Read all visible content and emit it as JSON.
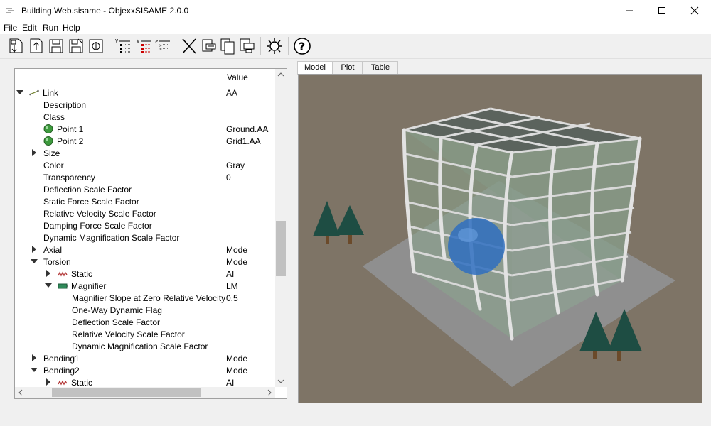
{
  "window": {
    "title": "Building.Web.sisame - ObjexxSISAME 2.0.0"
  },
  "menu": [
    "File",
    "Edit",
    "Run",
    "Help"
  ],
  "toolbar": {
    "icons": [
      "new-icon",
      "open-icon",
      "save-icon",
      "save-as-icon",
      "close-file-icon",
      "tree-expand-icon",
      "tree-list-icon",
      "tree-values-icon",
      "delete-icon",
      "cut-icon",
      "copy-icon",
      "paste-icon",
      "settings-icon",
      "help-icon"
    ]
  },
  "tree": {
    "header_value": "Value",
    "rows": [
      {
        "label": "Link",
        "value": "AA",
        "depth": 0,
        "arrow": "down",
        "icon": "link"
      },
      {
        "label": "Description",
        "value": "",
        "depth": 1,
        "arrow": "",
        "icon": ""
      },
      {
        "label": "Class",
        "value": "",
        "depth": 1,
        "arrow": "",
        "icon": ""
      },
      {
        "label": "Point 1",
        "value": "Ground.AA",
        "depth": 1,
        "arrow": "",
        "icon": "point"
      },
      {
        "label": "Point 2",
        "value": "Grid1.AA",
        "depth": 1,
        "arrow": "",
        "icon": "point"
      },
      {
        "label": "Size",
        "value": "",
        "depth": 1,
        "arrow": "right",
        "icon": ""
      },
      {
        "label": "Color",
        "value": "Gray",
        "depth": 1,
        "arrow": "",
        "icon": ""
      },
      {
        "label": "Transparency",
        "value": "0",
        "depth": 1,
        "arrow": "",
        "icon": ""
      },
      {
        "label": "Deflection Scale Factor",
        "value": "",
        "depth": 1,
        "arrow": "",
        "icon": ""
      },
      {
        "label": "Static Force Scale Factor",
        "value": "",
        "depth": 1,
        "arrow": "",
        "icon": ""
      },
      {
        "label": "Relative Velocity Scale Factor",
        "value": "",
        "depth": 1,
        "arrow": "",
        "icon": ""
      },
      {
        "label": "Damping Force Scale Factor",
        "value": "",
        "depth": 1,
        "arrow": "",
        "icon": ""
      },
      {
        "label": "Dynamic Magnification Scale Factor",
        "value": "",
        "depth": 1,
        "arrow": "",
        "icon": ""
      },
      {
        "label": "Axial",
        "value": "Mode",
        "depth": 1,
        "arrow": "right",
        "icon": ""
      },
      {
        "label": "Torsion",
        "value": "Mode",
        "depth": 1,
        "arrow": "down",
        "icon": ""
      },
      {
        "label": "Static",
        "value": "AI",
        "depth": 2,
        "arrow": "right",
        "icon": "spring"
      },
      {
        "label": "Magnifier",
        "value": "LM",
        "depth": 2,
        "arrow": "down",
        "icon": "magnifier"
      },
      {
        "label": "Magnifier Slope at Zero Relative Velocity",
        "value": "0.5",
        "depth": 3,
        "arrow": "",
        "icon": ""
      },
      {
        "label": "One-Way Dynamic Flag",
        "value": "",
        "depth": 3,
        "arrow": "",
        "icon": ""
      },
      {
        "label": "Deflection Scale Factor",
        "value": "",
        "depth": 3,
        "arrow": "",
        "icon": ""
      },
      {
        "label": "Relative Velocity Scale Factor",
        "value": "",
        "depth": 3,
        "arrow": "",
        "icon": ""
      },
      {
        "label": "Dynamic Magnification Scale Factor",
        "value": "",
        "depth": 3,
        "arrow": "",
        "icon": ""
      },
      {
        "label": "Bending1",
        "value": "Mode",
        "depth": 1,
        "arrow": "right",
        "icon": ""
      },
      {
        "label": "Bending2",
        "value": "Mode",
        "depth": 1,
        "arrow": "down",
        "icon": ""
      },
      {
        "label": "Static",
        "value": "AI",
        "depth": 2,
        "arrow": "right",
        "icon": "spring"
      }
    ]
  },
  "tabs": [
    "Model",
    "Plot",
    "Table"
  ],
  "active_tab": "Model",
  "colors": {
    "viewport_bg": "#7e7466",
    "ground": "#8f8f8f",
    "sphere": "#2f6fc0",
    "tree_green": "#1e4d43"
  }
}
